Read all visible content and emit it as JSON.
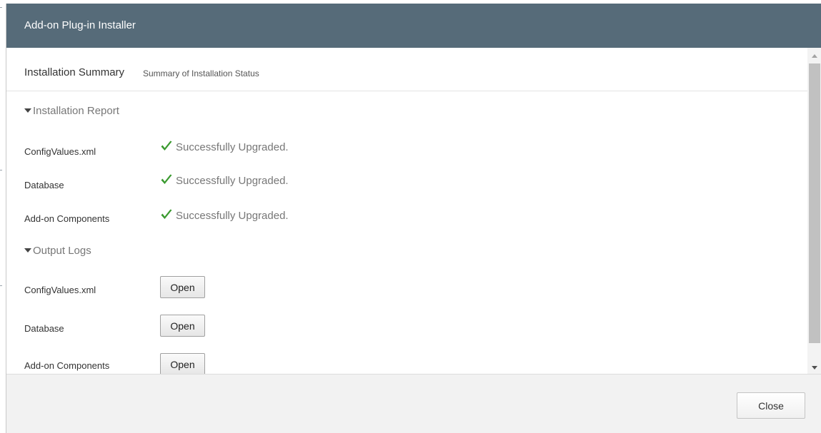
{
  "dialog": {
    "title": "Add-on Plug-in Installer"
  },
  "summary": {
    "title": "Installation Summary",
    "subtitle": "Summary of Installation Status"
  },
  "report": {
    "heading": "Installation Report",
    "rows": [
      {
        "label": "ConfigValues.xml",
        "status": "Successfully Upgraded."
      },
      {
        "label": "Database",
        "status": "Successfully Upgraded."
      },
      {
        "label": "Add-on Components",
        "status": "Successfully Upgraded."
      }
    ]
  },
  "logs": {
    "heading": "Output Logs",
    "rows": [
      {
        "label": "ConfigValues.xml",
        "button": "Open"
      },
      {
        "label": "Database",
        "button": "Open"
      },
      {
        "label": "Add-on Components",
        "button": "Open"
      }
    ]
  },
  "footer": {
    "close_label": "Close"
  },
  "colors": {
    "titlebar": "#566b79",
    "success": "#3a9a2f"
  }
}
